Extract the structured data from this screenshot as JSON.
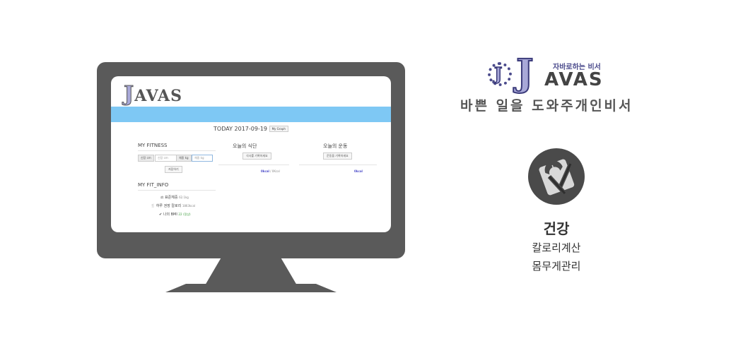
{
  "app": {
    "logo_j": "J",
    "logo_rest": "AVAS"
  },
  "screen": {
    "today_label": "TODAY 2017-09-19",
    "graph_button": "My Graph",
    "fitness": {
      "title": "MY FITNESS",
      "height_label": "신장 cm",
      "height_placeholder": "신장 cm",
      "weight_label": "체중 kg",
      "weight_placeholder": "체중 kg",
      "save_button": "저장하기"
    },
    "diet": {
      "title": "오늘의 식단",
      "button": "식사를 기록하세요",
      "kcal": "0kcal",
      "kcal_total": "/ 0Kcal"
    },
    "exercise": {
      "title": "오늘의 운동",
      "button": "운동을 기록하세요",
      "kcal": "0kcal"
    },
    "fit_info": {
      "title": "MY FIT_INFO",
      "std_weight_label": "표준체중",
      "std_weight_value": "62.1kg",
      "daily_cal_label": "하루 권장 칼로리",
      "daily_cal_value": "1863kcal",
      "bmi_label": "나의 BMI",
      "bmi_value": "22",
      "bmi_status": "(정상)"
    }
  },
  "brand": {
    "j_small": "J",
    "j_big": "J",
    "avas": "AVAS",
    "tagline": "자바로하는 비서",
    "slogan": "바쁜 일을 도와주개인비서"
  },
  "feature": {
    "icon": "scale-fork-knife-icon",
    "title": "건강",
    "line1": "칼로리계산",
    "line2": "몸무게관리"
  },
  "colors": {
    "monitor": "#5a5a5a",
    "header_bar": "#7ec8f4",
    "brand_accent": "#4b4b8c",
    "icon_bg": "#4a4a4a"
  }
}
